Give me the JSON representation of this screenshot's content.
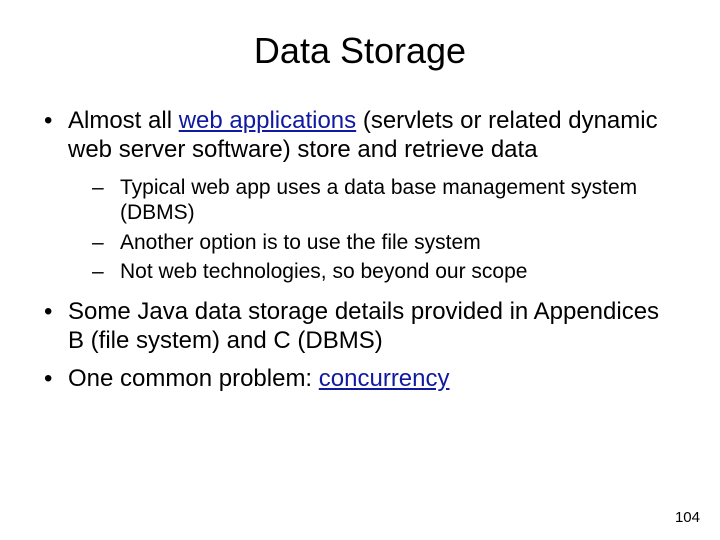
{
  "title": "Data Storage",
  "bullets": {
    "0": {
      "pre": "Almost all ",
      "link": "web applications",
      "post": " (servlets or related dynamic web server software) store and retrieve data",
      "sub": {
        "0": "Typical web app uses a data base management system (DBMS)",
        "1": "Another option is to use the file system",
        "2": "Not web technologies, so beyond our scope"
      }
    },
    "1": "Some Java data storage details provided in Appendices B (file system) and C (DBMS)",
    "2": {
      "pre": "One common problem: ",
      "link": "concurrency"
    }
  },
  "page_number": "104"
}
